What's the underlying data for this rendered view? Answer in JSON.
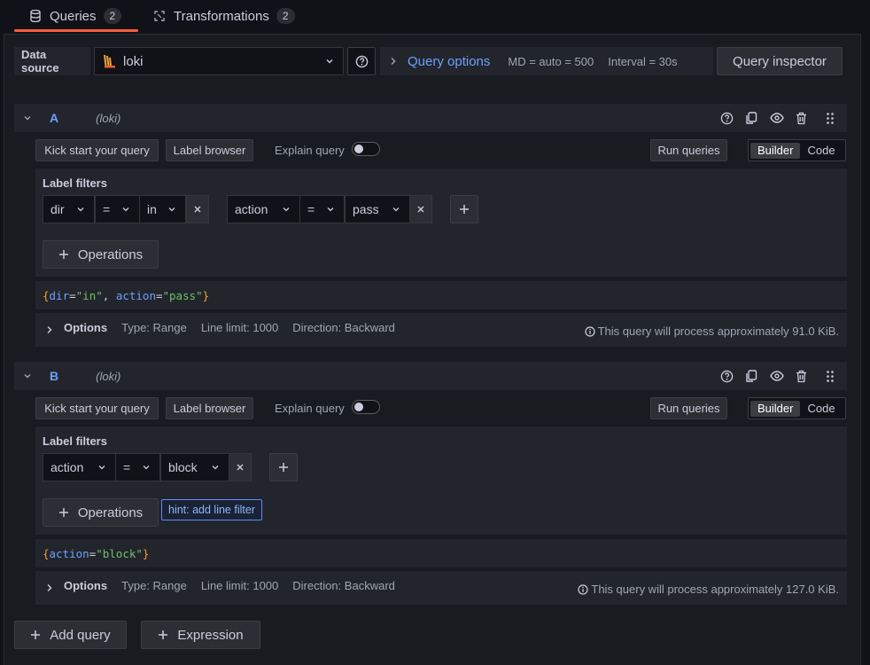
{
  "tabs": [
    {
      "label": "Queries",
      "count": "2"
    },
    {
      "label": "Transformations",
      "count": "2"
    }
  ],
  "toolbar": {
    "datasource_label": "Data source",
    "datasource_value": "loki",
    "query_options_label": "Query options",
    "md_text": "MD = auto = 500",
    "interval_text": "Interval = 30s",
    "inspector_label": "Query inspector"
  },
  "queries": [
    {
      "ref": "A",
      "ds": "(loki)",
      "kick_start": "Kick start your query",
      "label_browser": "Label browser",
      "explain": "Explain query",
      "run": "Run queries",
      "mode_builder": "Builder",
      "mode_code": "Code",
      "label_filters_title": "Label filters",
      "filters": [
        {
          "label": "dir",
          "op": "=",
          "value": "in"
        },
        {
          "label": "action",
          "op": "=",
          "value": "pass"
        }
      ],
      "operations": "Operations",
      "code_tokens": [
        "{",
        "dir",
        "=",
        "\"in\"",
        ", ",
        "action",
        "=",
        "\"pass\"",
        "}"
      ],
      "options_label": "Options",
      "type": "Type: Range",
      "line_limit": "Line limit: 1000",
      "direction": "Direction: Backward",
      "process": "This query will process approximately 91.0 KiB."
    },
    {
      "ref": "B",
      "ds": "(loki)",
      "kick_start": "Kick start your query",
      "label_browser": "Label browser",
      "explain": "Explain query",
      "run": "Run queries",
      "mode_builder": "Builder",
      "mode_code": "Code",
      "label_filters_title": "Label filters",
      "filters": [
        {
          "label": "action",
          "op": "=",
          "value": "block"
        }
      ],
      "operations": "Operations",
      "hint": "hint: add line filter",
      "code_tokens": [
        "{",
        "action",
        "=",
        "\"block\"",
        "}"
      ],
      "options_label": "Options",
      "type": "Type: Range",
      "line_limit": "Line limit: 1000",
      "direction": "Direction: Backward",
      "process": "This query will process approximately 127.0 KiB."
    }
  ],
  "footer": {
    "add_query": "Add query",
    "expression": "Expression"
  },
  "colors": {
    "accent_tab": "#f55f3e",
    "link_blue": "#6e9fff",
    "brace": "#ff9830",
    "string": "#73bf69"
  }
}
